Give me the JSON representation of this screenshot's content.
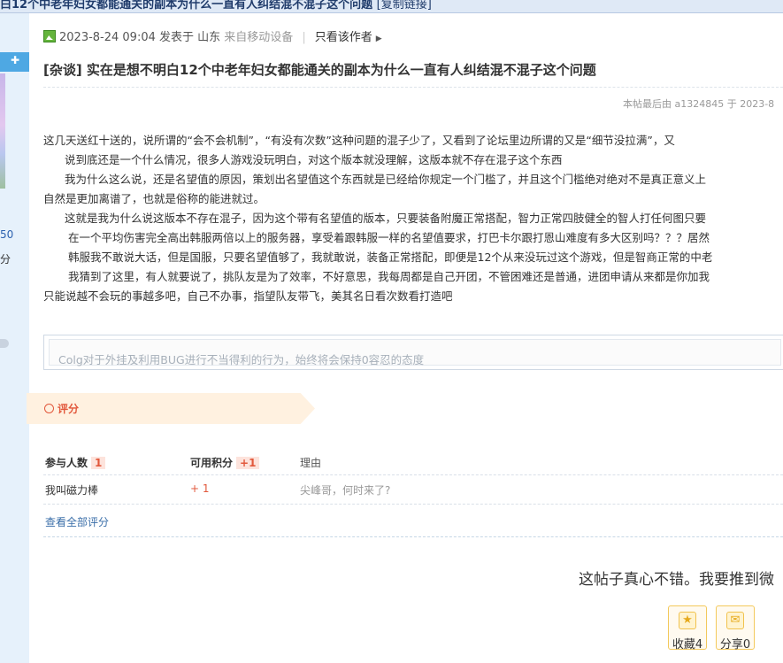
{
  "topbar": {
    "title": "白12个中老年妇女都能通关的副本为什么一直有人纠结混不混子这个问题",
    "copy_link": "[复制链接]"
  },
  "sidebar": {
    "number": "50",
    "points_label": "分"
  },
  "post_meta": {
    "date": "2023-8-24 09:04",
    "posted_in": "发表于 山东",
    "device": "来自移动设备",
    "only_author": "只看该作者"
  },
  "post": {
    "title": "[杂谈] 实在是想不明白12个中老年妇女都能通关的副本为什么一直有人纠结混不混子这个问题",
    "edited": "本帖最后由 a1324845 于 2023-8",
    "paragraphs": [
      "这几天送红十送的，说所谓的“会不会机制”，“有没有次数”这种问题的混子少了，又看到了论坛里边所谓的又是“细节没拉满”，又",
      "说到底还是一个什么情况，很多人游戏没玩明白，对这个版本就没理解，这版本就不存在混子这个东西",
      "我为什么这么说，还是名望值的原因，策划出名望值这个东西就是已经给你规定一个门槛了，并且这个门槛绝对绝对不是真正意义上",
      "自然是更加离谱了，也就是俗称的能进就过。",
      "这就是我为什么说这版本不存在混子，因为这个带有名望值的版本，只要装备附魔正常搭配，智力正常四肢健全的智人打任何图只要",
      "在一个平均伤害完全高出韩服两倍以上的服务器，享受着跟韩服一样的名望值要求，打巴卡尔跟打恩山难度有多大区别吗？？？居然",
      "韩服我不敢说大话，但是国服，只要名望值够了，我就敢说，装备正常搭配，即便是12个从来没玩过这个游戏，但是智商正常的中老",
      "我猜到了这里，有人就要说了，挑队友是为了效率，不好意思，我每周都是自己开团，不管困难还是普通，进团申请从来都是你加我",
      "只能说越不会玩的事越多吧，自己不办事，指望队友带飞，美其名日看次数看打造吧"
    ]
  },
  "policy": {
    "text": "Colg对于外挂及利用BUG进行不当得利的行为，始终将会保持0容忍的态度"
  },
  "rating": {
    "tab_label": "评分",
    "headers": {
      "participants": "参与人数",
      "participants_count": "1",
      "points": "可用积分",
      "points_total": "+1",
      "reason": "理由"
    },
    "rows": [
      {
        "user": "我叫磁力棒",
        "points": "+ 1",
        "reason": "尖峰哥，何时来了?"
      }
    ],
    "view_all": "查看全部评分"
  },
  "footer": {
    "recommend_text": "这帖子真心不错。我要推到微",
    "favorite_label": "收藏4",
    "share_label": "分享0"
  }
}
